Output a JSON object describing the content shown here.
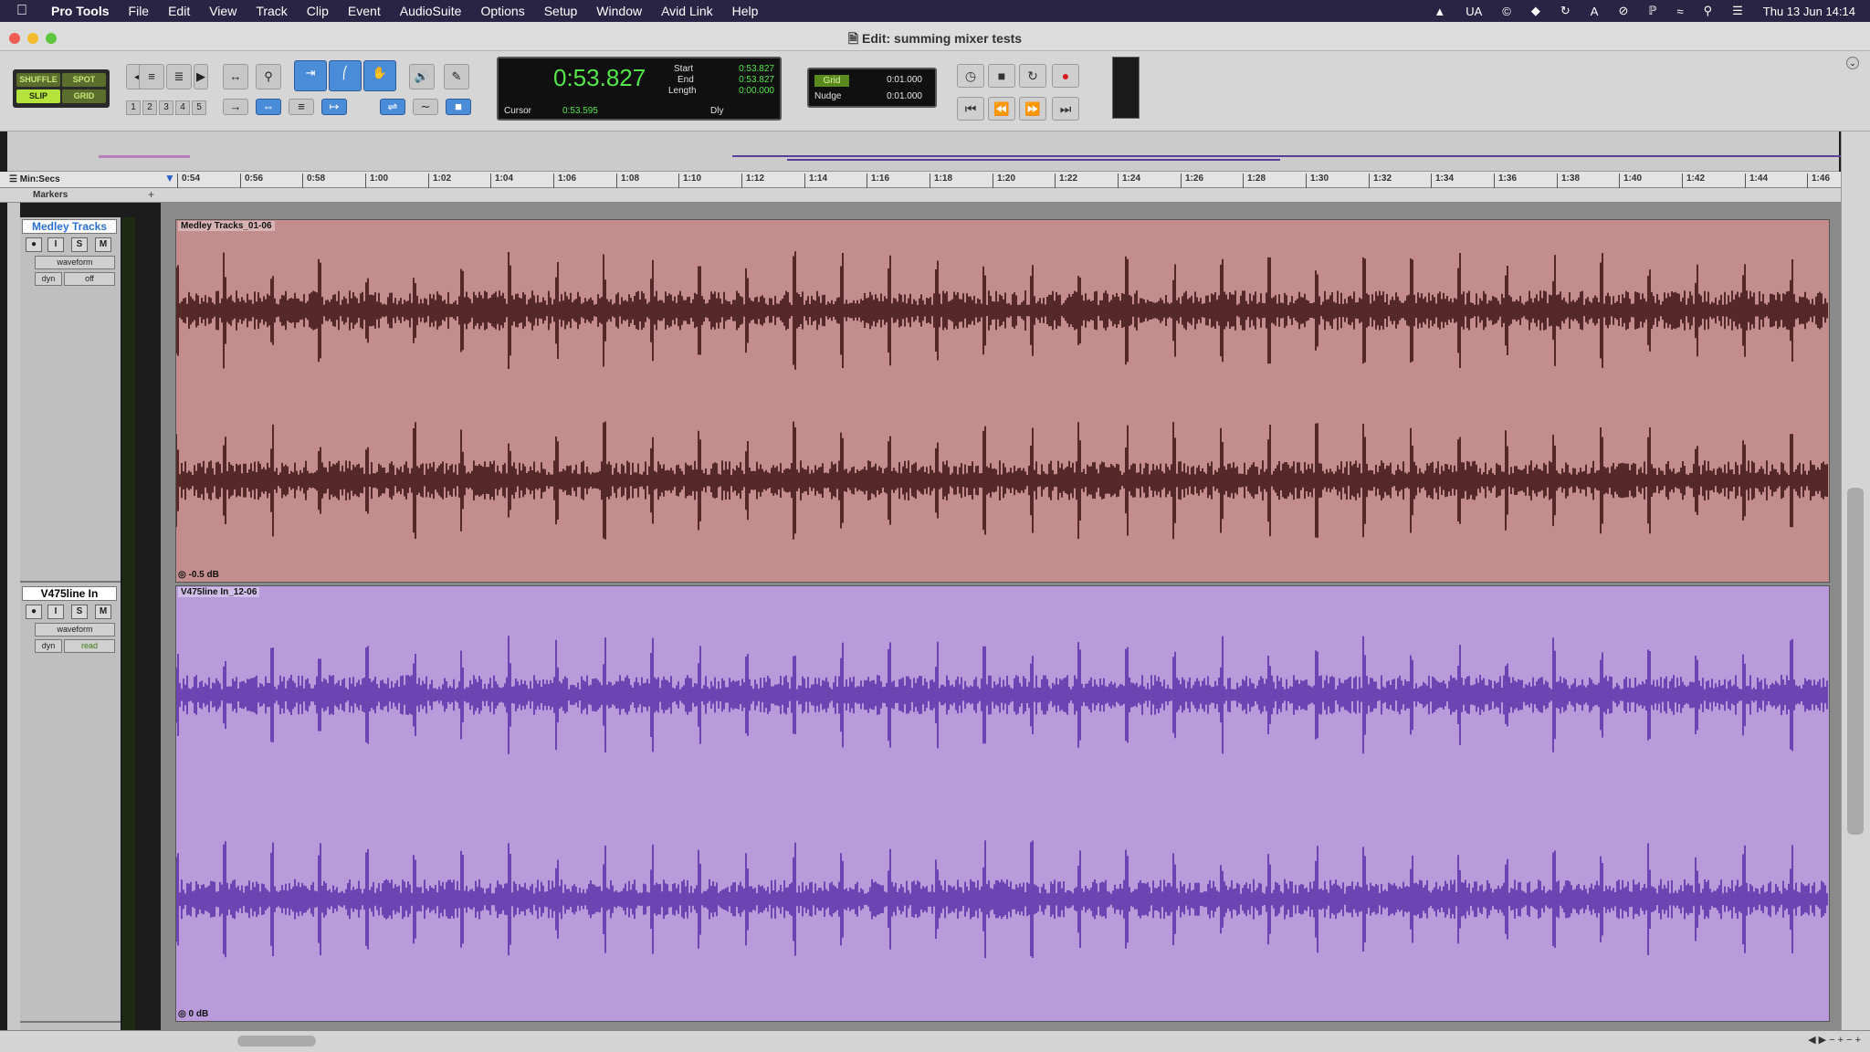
{
  "menubar": {
    "app": "Pro Tools",
    "items": [
      "File",
      "Edit",
      "View",
      "Track",
      "Clip",
      "Event",
      "AudioSuite",
      "Options",
      "Setup",
      "Window",
      "Avid Link",
      "Help"
    ],
    "status_text_ua": "UA",
    "clock": "Thu 13 Jun  14:14"
  },
  "window": {
    "title": "Edit: summing mixer tests"
  },
  "modes": {
    "shuffle": "SHUFFLE",
    "spot": "SPOT",
    "slip": "SLIP",
    "grid": "GRID"
  },
  "zoom_presets": [
    "1",
    "2",
    "3",
    "4",
    "5"
  ],
  "counter": {
    "main": "0:53.827",
    "start_label": "Start",
    "start": "0:53.827",
    "end_label": "End",
    "end": "0:53.827",
    "length_label": "Length",
    "length": "0:00.000",
    "cursor_label": "Cursor",
    "cursor": "0:53.595",
    "dly": "Dly"
  },
  "grid": {
    "grid_label": "Grid",
    "grid_value": "0:01.000",
    "nudge_label": "Nudge",
    "nudge_value": "0:01.000"
  },
  "ruler": {
    "label": "Min:Secs",
    "markers_label": "Markers",
    "ticks": [
      "0:54",
      "0:56",
      "0:58",
      "1:00",
      "1:02",
      "1:04",
      "1:06",
      "1:08",
      "1:10",
      "1:12",
      "1:14",
      "1:16",
      "1:18",
      "1:20",
      "1:22",
      "1:24",
      "1:26",
      "1:28",
      "1:30",
      "1:32",
      "1:34",
      "1:36",
      "1:38",
      "1:40",
      "1:42",
      "1:44",
      "1:46"
    ]
  },
  "tracks": [
    {
      "name": "Medley Tracks",
      "view": "waveform",
      "dyn": "dyn",
      "automation": "off",
      "clip_name": "Medley Tracks_01-06",
      "gain": "-0.5 dB",
      "color": "#c48d8d",
      "wave_color": "#3a1010"
    },
    {
      "name": "V475line In",
      "view": "waveform",
      "dyn": "dyn",
      "automation": "read",
      "clip_name": "V475line In_12-06",
      "gain": "0 dB",
      "color": "#b99bdc",
      "wave_color": "#5a2fa8"
    }
  ],
  "track_buttons": {
    "rec": "●",
    "input": "I",
    "solo": "S",
    "mute": "M"
  },
  "colors": {
    "menubar": "#2a2444",
    "counter_text": "#54e64a",
    "selected_tool": "#4a8cd8"
  }
}
